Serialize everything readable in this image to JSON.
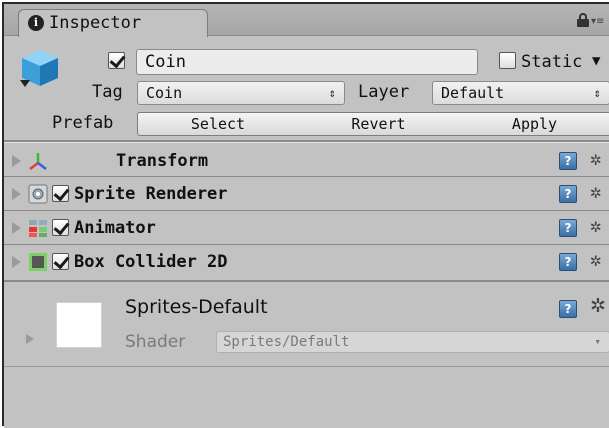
{
  "tab": {
    "title": "Inspector"
  },
  "object": {
    "name": "Coin",
    "static_label": "Static",
    "tag_label": "Tag",
    "tag_value": "Coin",
    "layer_label": "Layer",
    "layer_value": "Default",
    "prefab_label": "Prefab",
    "prefab_buttons": [
      "Select",
      "Revert",
      "Apply"
    ]
  },
  "components": [
    {
      "name": "Transform",
      "icon": "transform-icon",
      "has_checkbox": false
    },
    {
      "name": "Sprite Renderer",
      "icon": "sprite-renderer-icon",
      "has_checkbox": true,
      "checked": true
    },
    {
      "name": "Animator",
      "icon": "animator-icon",
      "has_checkbox": true,
      "checked": true
    },
    {
      "name": "Box Collider 2D",
      "icon": "box-collider-2d-icon",
      "has_checkbox": true,
      "checked": true
    }
  ],
  "material": {
    "name": "Sprites-Default",
    "shader_label": "Shader",
    "shader_value": "Sprites/Default"
  },
  "colors": {
    "panel_bg": "#c2c2c2",
    "help_icon": "#3a6ea5",
    "transform_axes": [
      "#e23b3b",
      "#3bb83b",
      "#3b5de2"
    ]
  }
}
